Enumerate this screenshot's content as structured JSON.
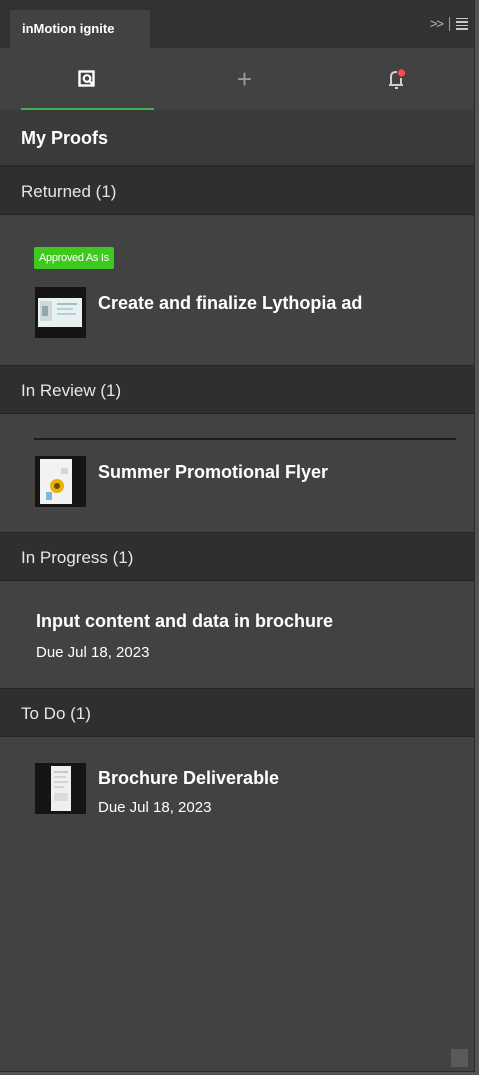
{
  "panel": {
    "tab_label": "inMotion ignite",
    "collapse_glyph": ">>",
    "nav": {
      "tabs": [
        {
          "name": "proofs",
          "icon": "proof-search-icon",
          "active": true
        },
        {
          "name": "add",
          "icon": "plus-icon",
          "glyph": "+"
        },
        {
          "name": "notifications",
          "icon": "bell-icon",
          "has_alert": true
        }
      ]
    },
    "colors": {
      "accent": "#39b54a",
      "badge": "#3ec91e",
      "alert_dot": "#ff4b4b"
    }
  },
  "main": {
    "title": "My Proofs",
    "sections": [
      {
        "header": "Returned (1)",
        "items": [
          {
            "badge": "Approved As Is",
            "title": "Create and finalize Lythopia ad",
            "thumb_icon": "proof-thumbnail"
          }
        ]
      },
      {
        "header": "In Review (1)",
        "items": [
          {
            "title": "Summer Promotional Flyer",
            "thumb_icon": "flyer-thumbnail"
          }
        ]
      },
      {
        "header": "In Progress (1)",
        "items": [
          {
            "title": "Input content and data in brochure",
            "due": "Due Jul 18, 2023"
          }
        ]
      },
      {
        "header": "To Do (1)",
        "items": [
          {
            "title": "Brochure Deliverable",
            "due": "Due Jul 18, 2023",
            "thumb_icon": "brochure-thumbnail"
          }
        ]
      }
    ]
  }
}
